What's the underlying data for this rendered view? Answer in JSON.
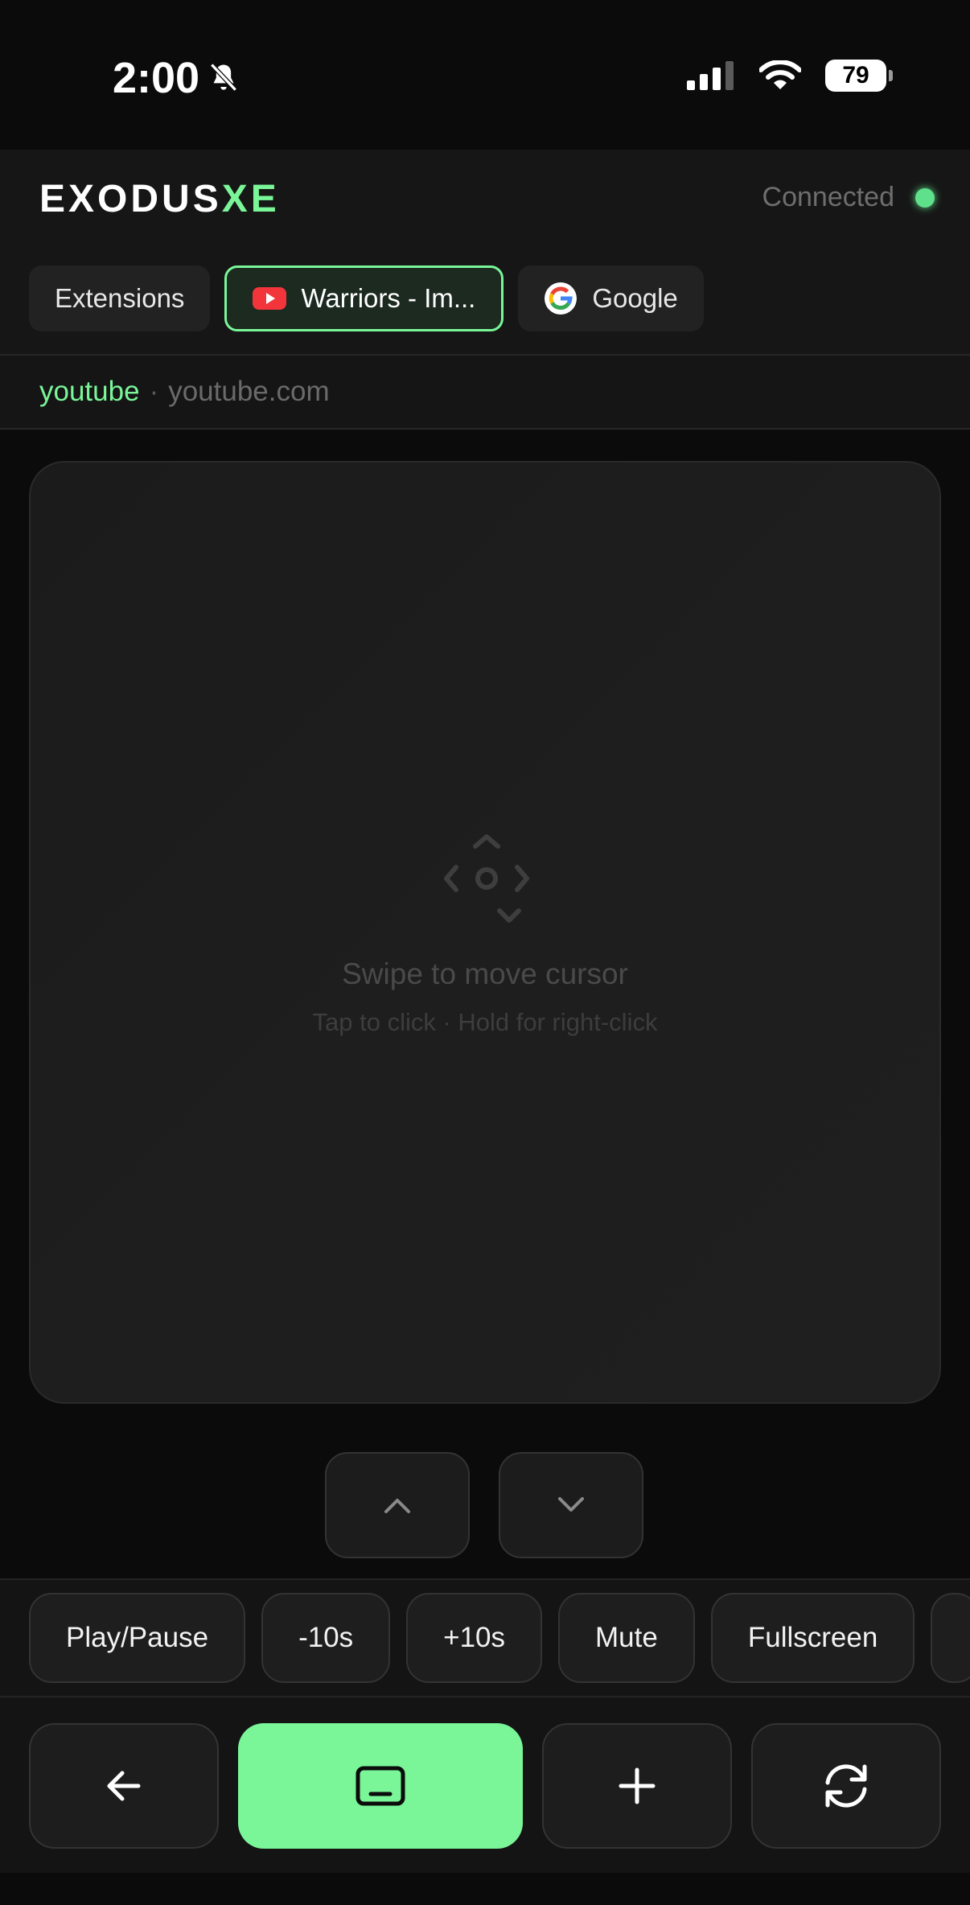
{
  "status_bar": {
    "time": "2:00",
    "battery": "79",
    "icons": [
      "bell-slash-icon",
      "cellular-signal-icon",
      "wifi-icon",
      "battery-icon"
    ]
  },
  "header": {
    "logo_main": "EXODUS",
    "logo_accent": "XE",
    "connection_status": "Connected",
    "accent_color": "#7af598"
  },
  "tabs": [
    {
      "label": "Extensions",
      "icon": null,
      "active": false
    },
    {
      "label": "Warriors - Im...",
      "icon": "youtube-icon",
      "active": true
    },
    {
      "label": "Google",
      "icon": "google-icon",
      "active": false
    }
  ],
  "url_bar": {
    "site": "youtube",
    "separator": "·",
    "domain": "youtube.com"
  },
  "trackpad": {
    "icon": "move-cursor-icon",
    "title": "Swipe to move cursor",
    "subtitle": "Tap to click · Hold for right-click"
  },
  "scroll_buttons": {
    "up_icon": "chevron-up-icon",
    "down_icon": "chevron-down-icon"
  },
  "media_controls": [
    "Play/Pause",
    "-10s",
    "+10s",
    "Mute",
    "Fullscreen"
  ],
  "nav_buttons": {
    "back_icon": "arrow-left-icon",
    "keyboard_icon": "keyboard-icon",
    "add_icon": "plus-icon",
    "refresh_icon": "refresh-icon"
  }
}
